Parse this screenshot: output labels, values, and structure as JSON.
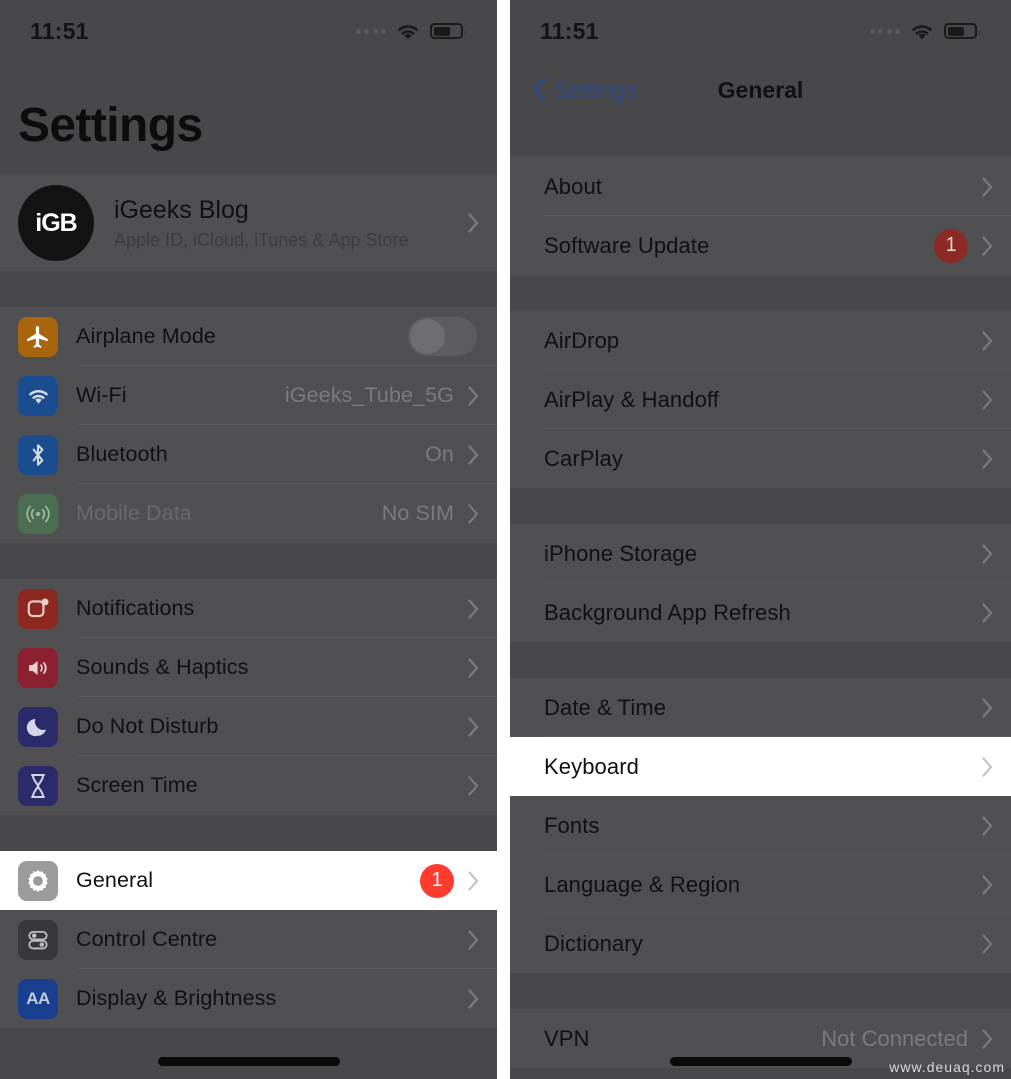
{
  "left_panel": {
    "status_bar": {
      "time": "11:51",
      "wifi_icon": "wifi-icon",
      "battery_icon": "battery-icon"
    },
    "title": "Settings",
    "account": {
      "avatar_text": "iGB",
      "name": "iGeeks Blog",
      "subtitle": "Apple ID, iCloud, iTunes & App Store"
    },
    "group_connectivity": [
      {
        "label": "Airplane Mode",
        "icon": "airplane-icon",
        "icon_color": "#a8650d",
        "control": "toggle",
        "toggle_on": false
      },
      {
        "label": "Wi-Fi",
        "icon": "wifi-icon",
        "icon_color": "#1a4d8f",
        "value": "iGeeks_Tube_5G",
        "control": "chevron"
      },
      {
        "label": "Bluetooth",
        "icon": "bluetooth-icon",
        "icon_color": "#1a4d8f",
        "value": "On",
        "control": "chevron"
      },
      {
        "label": "Mobile Data",
        "icon": "cellular-icon",
        "icon_color": "#4b6e50",
        "value": "No SIM",
        "control": "chevron",
        "muted": true
      }
    ],
    "group_alerts": [
      {
        "label": "Notifications",
        "icon": "notifications-icon",
        "icon_color": "#8c281f",
        "control": "chevron"
      },
      {
        "label": "Sounds & Haptics",
        "icon": "sounds-icon",
        "icon_color": "#8c2030",
        "control": "chevron"
      },
      {
        "label": "Do Not Disturb",
        "icon": "moon-icon",
        "icon_color": "#2b2b6b",
        "control": "chevron"
      },
      {
        "label": "Screen Time",
        "icon": "hourglass-icon",
        "icon_color": "#2b2b6b",
        "control": "chevron"
      }
    ],
    "group_system": [
      {
        "label": "General",
        "icon": "gear-icon",
        "icon_color": "#9b9b9d",
        "badge": "1",
        "control": "chevron",
        "highlighted": true
      },
      {
        "label": "Control Centre",
        "icon": "control-centre-icon",
        "icon_color": "#38383a",
        "control": "chevron"
      },
      {
        "label": "Display & Brightness",
        "icon": "display-brightness-icon",
        "icon_color": "#1a3f8f",
        "control": "chevron"
      }
    ]
  },
  "right_panel": {
    "status_bar": {
      "time": "11:51",
      "wifi_icon": "wifi-icon",
      "battery_icon": "battery-icon"
    },
    "nav": {
      "back_label": "Settings",
      "back_icon": "chevron-left-icon",
      "title": "General"
    },
    "group_info": [
      {
        "label": "About",
        "control": "chevron"
      },
      {
        "label": "Software Update",
        "badge": "1",
        "control": "chevron"
      }
    ],
    "group_sharing": [
      {
        "label": "AirDrop",
        "control": "chevron"
      },
      {
        "label": "AirPlay & Handoff",
        "control": "chevron"
      },
      {
        "label": "CarPlay",
        "control": "chevron"
      }
    ],
    "group_storage": [
      {
        "label": "iPhone Storage",
        "control": "chevron"
      },
      {
        "label": "Background App Refresh",
        "control": "chevron"
      }
    ],
    "group_locale": [
      {
        "label": "Date & Time",
        "control": "chevron"
      },
      {
        "label": "Keyboard",
        "control": "chevron",
        "highlighted": true
      },
      {
        "label": "Fonts",
        "control": "chevron"
      },
      {
        "label": "Language & Region",
        "control": "chevron"
      },
      {
        "label": "Dictionary",
        "control": "chevron"
      }
    ],
    "group_network": [
      {
        "label": "VPN",
        "value": "Not Connected",
        "control": "chevron"
      }
    ]
  },
  "watermark": "www.deuaq.com",
  "colors": {
    "badge_bright": "#ff3b30",
    "badge_dim": "#8d2a25",
    "accent_blue": "#2d4a86",
    "panel_bg": "#48484a",
    "row_bg": "#505052",
    "highlight_bg": "#ffffff"
  }
}
